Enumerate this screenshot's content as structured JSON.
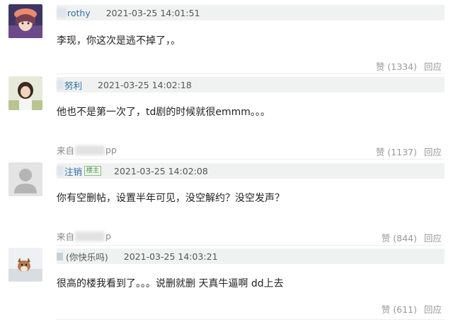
{
  "comments": [
    {
      "author": "rothy",
      "time": "2021-03-25 14:01:51",
      "content": "李现，你这次是逃不掉了，。",
      "likes": "赞 (1334)",
      "reply": "回应"
    },
    {
      "author": "努利",
      "time": "2021-03-25 14:02:18",
      "content": "他也不是第一次了，td剧的时候就很emmm。。。",
      "source_prefix": "来自",
      "source_suffix": "pp",
      "likes": "赞 (1137)",
      "reply": "回应"
    },
    {
      "author": "注销",
      "badge": "楼主",
      "time": "2021-03-25 14:02:08",
      "content": "你有空删帖，设置半年可见，没空解约？没空发声？",
      "source_prefix": "来自",
      "source_suffix": "p",
      "likes": "赞 (844)",
      "reply": "回应"
    },
    {
      "author": "(你快乐吗)",
      "time": "2021-03-25 14:03:21",
      "content": "很高的楼我看到了。。。说删就删 天真牛逼啊 dd上去",
      "likes": "赞 (611)",
      "reply": "回应"
    }
  ],
  "icons": [
    "avatar-anime-girl",
    "avatar-photo-girl",
    "avatar-default-person",
    "avatar-dog",
    "file-icon"
  ],
  "colors": {
    "author": "#2f6fa7",
    "meta_bar": "#f0f2f1",
    "badge": "#4a9a3d"
  }
}
